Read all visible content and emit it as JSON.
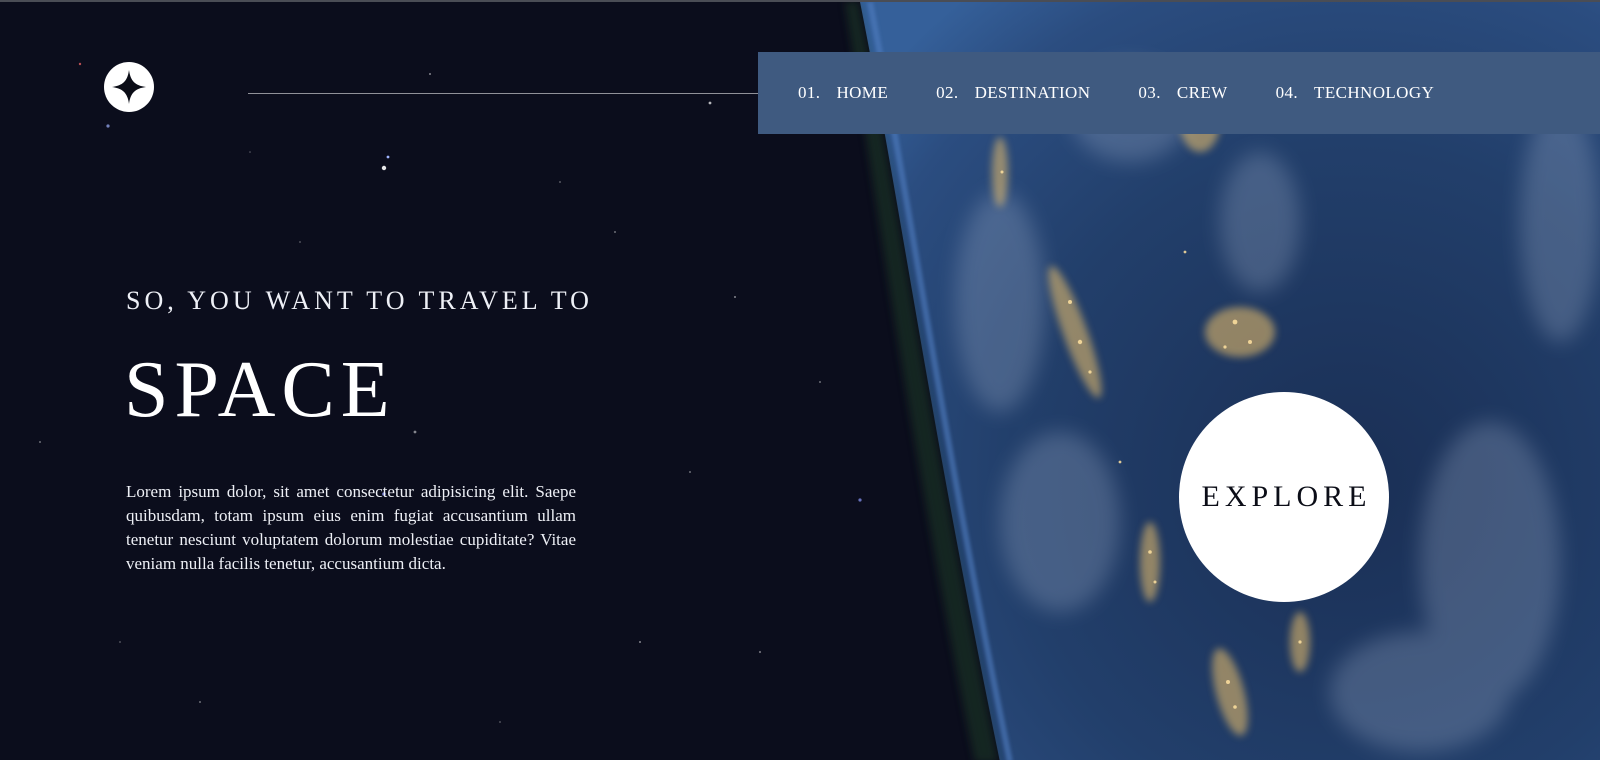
{
  "logo": {
    "icon": "four-point-star-icon"
  },
  "nav": {
    "items": [
      {
        "num": "01.",
        "label": "HOME"
      },
      {
        "num": "02.",
        "label": "DESTINATION"
      },
      {
        "num": "03.",
        "label": "CREW"
      },
      {
        "num": "04.",
        "label": "TECHNOLOGY"
      }
    ]
  },
  "hero": {
    "eyebrow": "SO, YOU WANT TO TRAVEL TO",
    "title": "SPACE",
    "description": "Lorem ipsum dolor, sit amet consectetur adipisicing elit. Saepe quibusdam, totam ipsum eius enim fugiat accusantium ullam tenetur nesciunt voluptatem dolorum molestiae cupiditate? Vitae veniam nulla facilis tenetur, accusantium dicta.",
    "explore_label": "EXPLORE"
  },
  "colors": {
    "background": "#0b0d1c",
    "nav_background": "#3f5a80",
    "text": "#ffffff",
    "button_text": "#0b0d17"
  }
}
